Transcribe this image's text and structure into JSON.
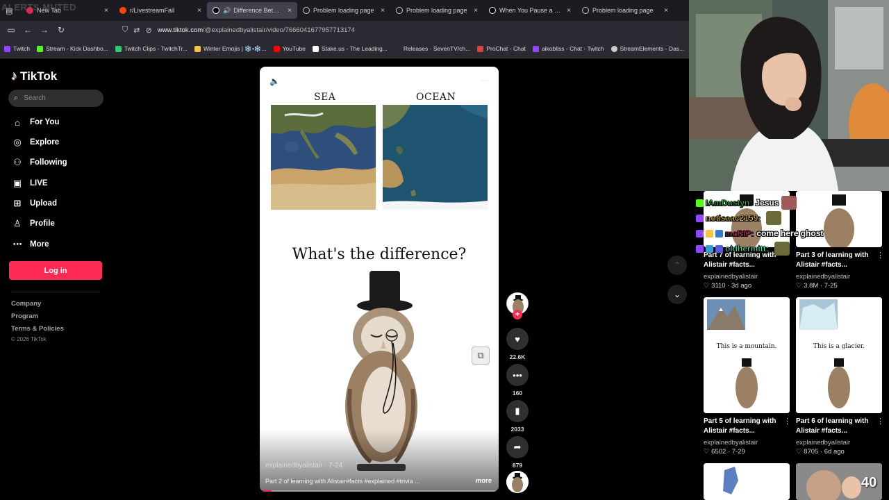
{
  "browser": {
    "alerts_overlay": "ALERTS MUTED",
    "tabs": [
      {
        "label": "New Tab",
        "color": "#e22850",
        "active": false
      },
      {
        "label": "r/LivestreamFail",
        "color": "#ff4500",
        "active": false
      },
      {
        "label": "Difference Between: Fa",
        "color": "#ffffff",
        "active": true
      },
      {
        "label": "Problem loading page",
        "color": "#cccccc",
        "active": false
      },
      {
        "label": "Problem loading page",
        "color": "#cccccc",
        "active": false
      },
      {
        "label": "When You Pause a Show to",
        "color": "#ffffff",
        "active": false
      },
      {
        "label": "Problem loading page",
        "color": "#cccccc",
        "active": false
      }
    ],
    "close_glyph": "×",
    "url_host": "www.tiktok.com",
    "url_path": "/@explainedbyalistair/video/7666041677957713174",
    "bookmarks": [
      {
        "label": "Twitch",
        "color": "#9146ff"
      },
      {
        "label": "Stream - Kick Dashbo...",
        "color": "#53fc18"
      },
      {
        "label": "Twitch Clips - TwitchTr...",
        "color": "#2ecc71"
      },
      {
        "label": "Winter Emojis | ❄️•❄️...",
        "color": "#f0c14b"
      },
      {
        "label": "YouTube",
        "color": "#ff0000"
      },
      {
        "label": "Stake.us - The Leading...",
        "color": "#ffffff"
      },
      {
        "label": "Releases · SevenTV/ch...",
        "color": "#2b2a33"
      },
      {
        "label": "ProChat - Chat",
        "color": "#e04040"
      },
      {
        "label": "aikobliss - Chat - Twitch",
        "color": "#9146ff"
      },
      {
        "label": "StreamElements - Das...",
        "color": "#cccccc"
      }
    ]
  },
  "tiktok": {
    "brand": "TikTok",
    "search_placeholder": "Search",
    "menu": [
      {
        "label": "For You",
        "icon": "home-icon"
      },
      {
        "label": "Explore",
        "icon": "compass-icon"
      },
      {
        "label": "Following",
        "icon": "person-icon"
      },
      {
        "label": "LIVE",
        "icon": "live-icon"
      },
      {
        "label": "Upload",
        "icon": "plus-square-icon"
      },
      {
        "label": "Profile",
        "icon": "person-icon"
      },
      {
        "label": "More",
        "icon": "more-icon"
      }
    ],
    "login_label": "Log in",
    "footer_links": [
      "Company",
      "Program",
      "Terms & Policies"
    ],
    "copyright": "© 2026 TikTok"
  },
  "video": {
    "label_left": "SEA",
    "label_right": "OCEAN",
    "question": "What's the difference?",
    "author": "explainedbyalistair · 7-24",
    "caption": "Part 2 of learning with Alistair#facts #explained #trivia ...",
    "more_label": "more",
    "progress": 0.05,
    "likes": "22.6K",
    "comments": "160",
    "saves": "2033",
    "shares": "879"
  },
  "recommendations": [
    {
      "title": "Part 7 of learning with Alistair #facts...",
      "author": "explainedbyalistair",
      "likes": "3110",
      "date": "3d ago",
      "thumb_text": ""
    },
    {
      "title": "Part 3 of learning with Alistair #facts...",
      "author": "explainedbyalistair",
      "likes": "3.8M",
      "date": "7-25",
      "thumb_text": ""
    },
    {
      "title": "Part 5 of learning with Alistair #facts...",
      "author": "explainedbyalistair",
      "likes": "6502",
      "date": "7-29",
      "thumb_text": "This is a mountain."
    },
    {
      "title": "Part 6 of learning with Alistair #facts...",
      "author": "explainedbyalistair",
      "likes": "8705",
      "date": "6d ago",
      "thumb_text": "This is a glacier."
    }
  ],
  "chat": [
    {
      "user": "IAmDustyn:",
      "message": "Jesus",
      "color": "#2ecc40"
    },
    {
      "user": "notisaac2159:",
      "message": "",
      "color": "#f5c542"
    },
    {
      "user": "mcRIP:",
      "message": "come here ghost",
      "color": "#e0245e"
    },
    {
      "user": "oldhermitt:",
      "message": "",
      "color": "#4dffb8"
    }
  ],
  "viewer_count": "40"
}
